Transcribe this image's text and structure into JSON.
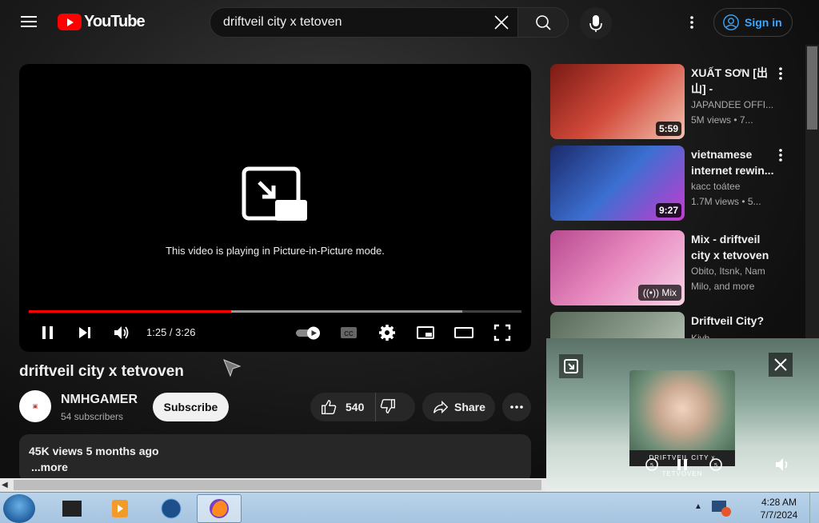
{
  "header": {
    "logo_text": "YouTube",
    "search_value": "driftveil city x tetoven",
    "signin_label": "Sign in"
  },
  "player": {
    "pip_message": "This video is playing in Picture-in-Picture mode.",
    "time_label": "1:25 / 3:26",
    "progress_played": 0.41,
    "progress_buffered": 0.88
  },
  "video": {
    "title": "driftveil city x tetvoven",
    "channel": "NMHGAMER",
    "subscribers": "54 subscribers",
    "subscribe_label": "Subscribe",
    "likes": "540",
    "share_label": "Share",
    "desc_stats": "45K views  5 months ago",
    "desc_more": "...more"
  },
  "sidebar": {
    "items": [
      {
        "title": "XUẤT SƠN [出山] - JAPANDE...",
        "channel": "JAPANDEE OFFI...",
        "meta": "5M views  • 7...",
        "badge": "5:59",
        "colors": [
          "#7a1a14",
          "#d24a3a",
          "#f3c1b0"
        ]
      },
      {
        "title": "vietnamese internet rewin...",
        "channel": "kacc toátee",
        "meta": "1.7M views  • 5...",
        "badge": "9:27",
        "colors": [
          "#1b2a6a",
          "#3c6fd1",
          "#c63ad0"
        ]
      },
      {
        "title": "Mix - driftveil city x tetvoven",
        "channel": "Obito, Itsnk, Nam",
        "meta": "Milo, and more",
        "badge": "Mix",
        "colors": [
          "#b74a8f",
          "#e88ac0",
          "#f6d3e6"
        ]
      },
      {
        "title": "Driftveil City?",
        "channel": "Kivh",
        "meta": "",
        "badge": "",
        "colors": [
          "#5a6a5a",
          "#8a9a8a",
          "#c9d2c9"
        ]
      }
    ]
  },
  "pip": {
    "caption": "DRIFTVEIL CITY x TETVOVEN"
  },
  "taskbar": {
    "time": "4:28 AM",
    "date": "7/7/2024"
  }
}
